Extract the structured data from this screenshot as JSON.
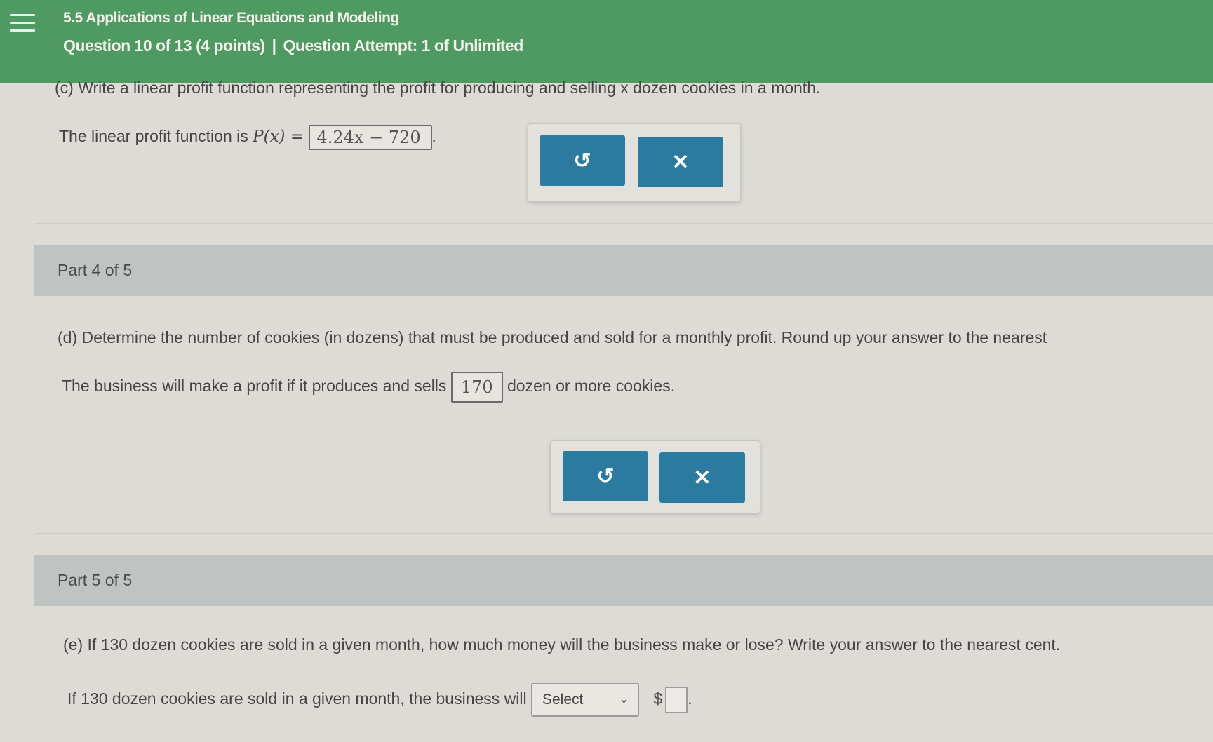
{
  "header": {
    "title": "5.5 Applications of Linear Equations and Modeling",
    "question_info": "Question 10 of 13 (4 points)",
    "separator": "|",
    "attempt_info": "Question Attempt: 1 of Unlimited"
  },
  "part_c": {
    "prompt": "(c) Write a linear profit function representing the profit for producing and selling x dozen cookies in a month.",
    "answer_prefix": "The linear profit function is",
    "function_name": "P(x) =",
    "answer_value": "4.24x − 720",
    "answer_suffix": "."
  },
  "part_d": {
    "bar_label": "Part 4 of 5",
    "prompt": "(d) Determine the number of cookies (in dozens) that must be produced and sold for a monthly profit. Round up your answer to the nearest",
    "answer_prefix": "The business will make a profit if it produces and sells",
    "answer_value": "170",
    "answer_suffix": "dozen or more cookies."
  },
  "part_e": {
    "bar_label": "Part 5 of 5",
    "prompt": "(e) If 130 dozen cookies are sold in a given month, how much money will the business make or lose? Write your answer to the nearest cent.",
    "answer_prefix": "If 130 dozen cookies are sold in a given month, the business will",
    "select_value": "Select",
    "currency": "$",
    "answer_suffix": "."
  },
  "buttons": {
    "undo_glyph": "↺",
    "clear_glyph": "✕"
  },
  "colors": {
    "header_bg": "#4f9a62",
    "button_bg": "#2b7aa0",
    "part_bar_bg": "#bfc4c2"
  }
}
